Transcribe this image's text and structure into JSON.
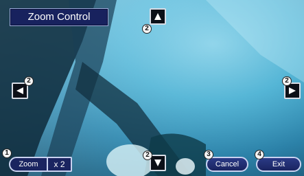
{
  "window": {
    "title": "Zoom Control"
  },
  "controls": {
    "zoom_label": "Zoom",
    "zoom_value": "x 2",
    "cancel_label": "Cancel",
    "exit_label": "Exit"
  },
  "callouts": {
    "arrow_up": "2",
    "arrow_left": "2",
    "arrow_right": "2",
    "arrow_down": "2",
    "zoom": "1",
    "cancel": "3",
    "exit": "4"
  },
  "icons": {
    "up": "arrow-up-icon",
    "down": "arrow-down-icon",
    "left": "arrow-left-icon",
    "right": "arrow-right-icon"
  },
  "colors": {
    "title_bg": "#18225e",
    "button_bg": "#1a2460",
    "button_border": "#c9d2f0"
  }
}
